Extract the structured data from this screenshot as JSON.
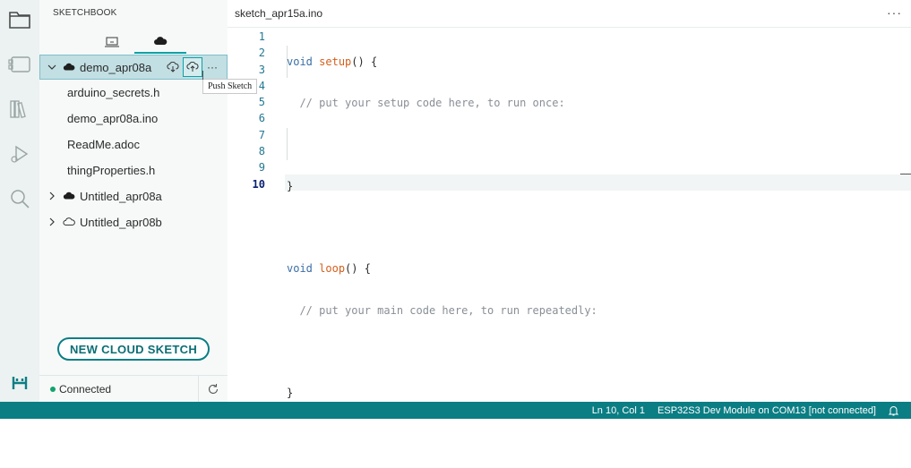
{
  "sidebar": {
    "title": "SKETCHBOOK",
    "tabs": [
      {
        "icon": "local-sketchbook-icon"
      },
      {
        "icon": "cloud-sketchbook-icon",
        "active": true
      }
    ],
    "tree": [
      {
        "label": "demo_apr08a",
        "expanded": true,
        "cloud": "filled"
      },
      {
        "label": "arduino_secrets.h"
      },
      {
        "label": "demo_apr08a.ino"
      },
      {
        "label": "ReadMe.adoc"
      },
      {
        "label": "thingProperties.h"
      },
      {
        "label": "Untitled_apr08a",
        "expanded": false,
        "cloud": "filled"
      },
      {
        "label": "Untitled_apr08b",
        "expanded": false,
        "cloud": "outline"
      }
    ],
    "row_actions": {
      "pull": "pull-sketch-icon",
      "push": "push-sketch-icon",
      "more": "···"
    },
    "tooltip": "Push Sketch",
    "new_cloud_button": "NEW CLOUD SKETCH",
    "status": "Connected"
  },
  "editor": {
    "tab_label": "sketch_apr15a.ino",
    "more": "···",
    "line_numbers": [
      "1",
      "2",
      "3",
      "4",
      "5",
      "6",
      "7",
      "8",
      "9",
      "10"
    ],
    "code": {
      "l1_kw": "void",
      "l1_fn": "setup",
      "l1_rest": "() {",
      "l2_comment": "// put your setup code here, to run once:",
      "l4": "}",
      "l6_kw": "void",
      "l6_fn": "loop",
      "l6_rest": "() {",
      "l7_comment": "// put your main code here, to run repeatedly:",
      "l9": "}"
    }
  },
  "statusbar": {
    "position": "Ln 10, Col 1",
    "board": "ESP32S3 Dev Module on COM13 [not connected]"
  },
  "colors": {
    "accent": "#0b7e84",
    "connected": "#13a36d"
  }
}
